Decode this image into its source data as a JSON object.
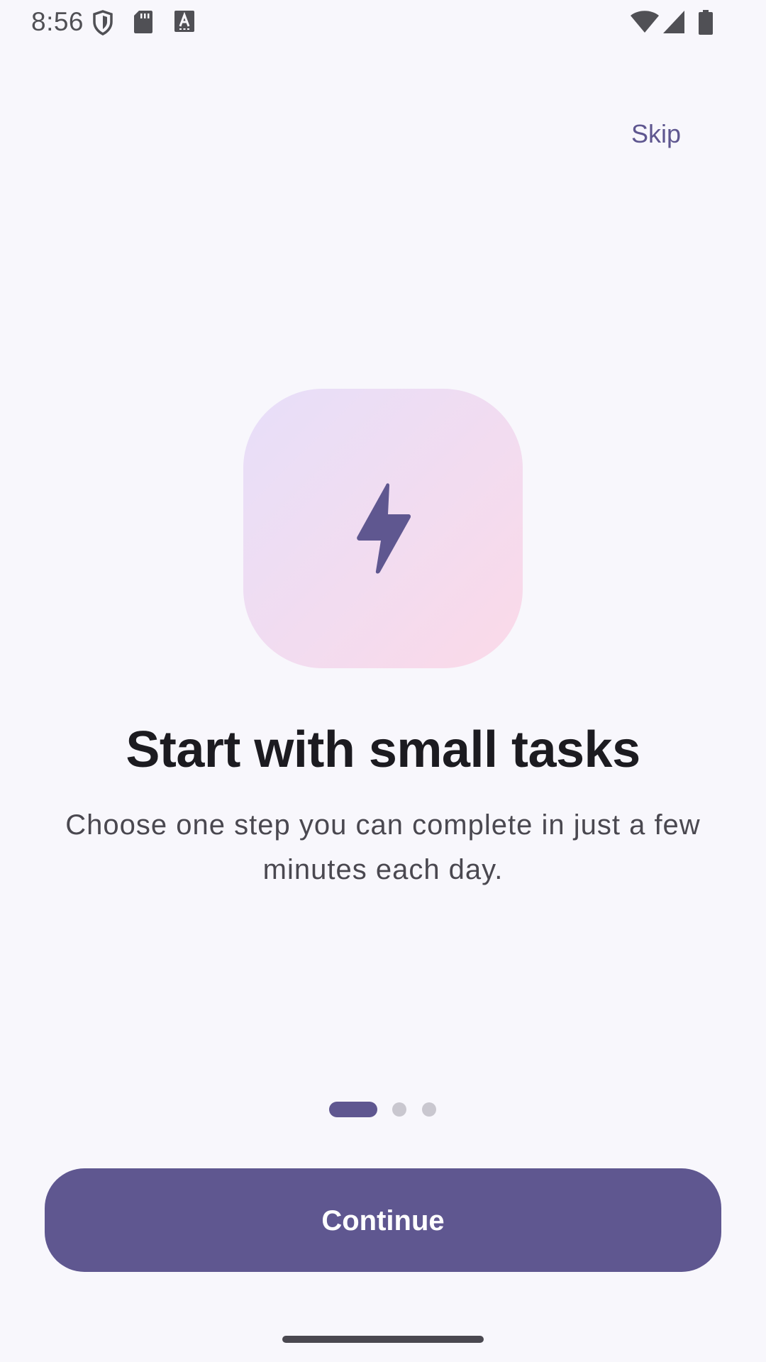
{
  "status_bar": {
    "time": "8:56",
    "icons": [
      "shield-icon",
      "sd-card-icon",
      "text-a-icon",
      "wifi-icon",
      "signal-icon",
      "battery-icon"
    ]
  },
  "header": {
    "skip_label": "Skip"
  },
  "hero": {
    "icon": "lightning-bolt-icon",
    "icon_color": "#5f5790",
    "tile_gradient": [
      "#e7dff9",
      "#fbd9e8"
    ]
  },
  "content": {
    "title": "Start with small tasks",
    "subtitle": "Choose one step you can complete in just a few minutes each day."
  },
  "pager": {
    "page_count": 3,
    "current_page": 1
  },
  "footer": {
    "continue_label": "Continue"
  },
  "colors": {
    "accent": "#5f5790",
    "background": "#f8f7fc",
    "inactive_dot": "#c9c7cf"
  }
}
